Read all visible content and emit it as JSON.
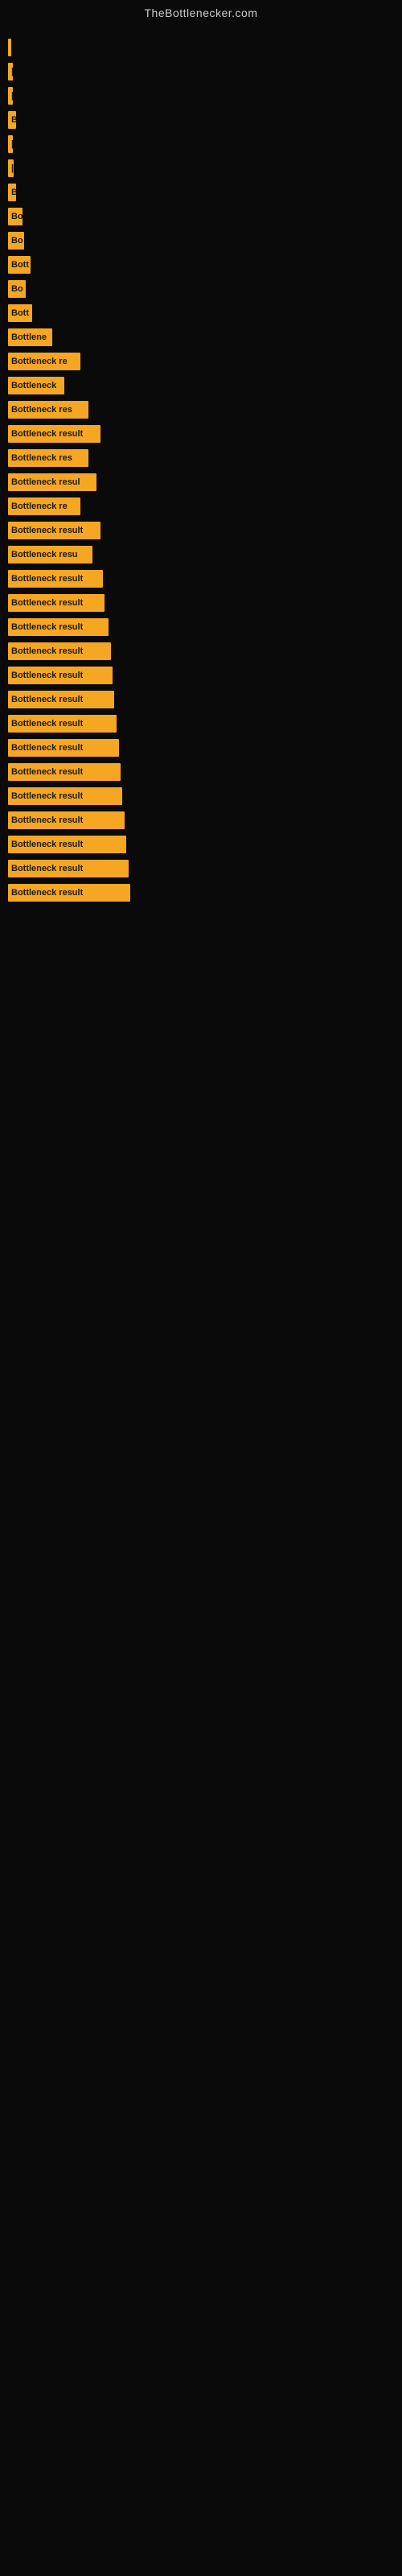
{
  "site": {
    "title": "TheBottlenecker.com"
  },
  "bars": [
    {
      "label": "|",
      "width": 4
    },
    {
      "label": "|",
      "width": 6
    },
    {
      "label": "|",
      "width": 6
    },
    {
      "label": "B",
      "width": 10
    },
    {
      "label": "|",
      "width": 6
    },
    {
      "label": "|",
      "width": 7
    },
    {
      "label": "B",
      "width": 10
    },
    {
      "label": "Bo",
      "width": 18
    },
    {
      "label": "Bo",
      "width": 20
    },
    {
      "label": "Bott",
      "width": 28
    },
    {
      "label": "Bo",
      "width": 22
    },
    {
      "label": "Bott",
      "width": 30
    },
    {
      "label": "Bottlene",
      "width": 55
    },
    {
      "label": "Bottleneck re",
      "width": 90
    },
    {
      "label": "Bottleneck",
      "width": 70
    },
    {
      "label": "Bottleneck res",
      "width": 100
    },
    {
      "label": "Bottleneck result",
      "width": 115
    },
    {
      "label": "Bottleneck res",
      "width": 100
    },
    {
      "label": "Bottleneck resul",
      "width": 110
    },
    {
      "label": "Bottleneck re",
      "width": 90
    },
    {
      "label": "Bottleneck result",
      "width": 115
    },
    {
      "label": "Bottleneck resu",
      "width": 105
    },
    {
      "label": "Bottleneck result",
      "width": 118
    },
    {
      "label": "Bottleneck result",
      "width": 120
    },
    {
      "label": "Bottleneck result",
      "width": 125
    },
    {
      "label": "Bottleneck result",
      "width": 128
    },
    {
      "label": "Bottleneck result",
      "width": 130
    },
    {
      "label": "Bottleneck result",
      "width": 132
    },
    {
      "label": "Bottleneck result",
      "width": 135
    },
    {
      "label": "Bottleneck result",
      "width": 138
    },
    {
      "label": "Bottleneck result",
      "width": 140
    },
    {
      "label": "Bottleneck result",
      "width": 142
    },
    {
      "label": "Bottleneck result",
      "width": 145
    },
    {
      "label": "Bottleneck result",
      "width": 147
    },
    {
      "label": "Bottleneck result",
      "width": 150
    },
    {
      "label": "Bottleneck result",
      "width": 152
    }
  ]
}
